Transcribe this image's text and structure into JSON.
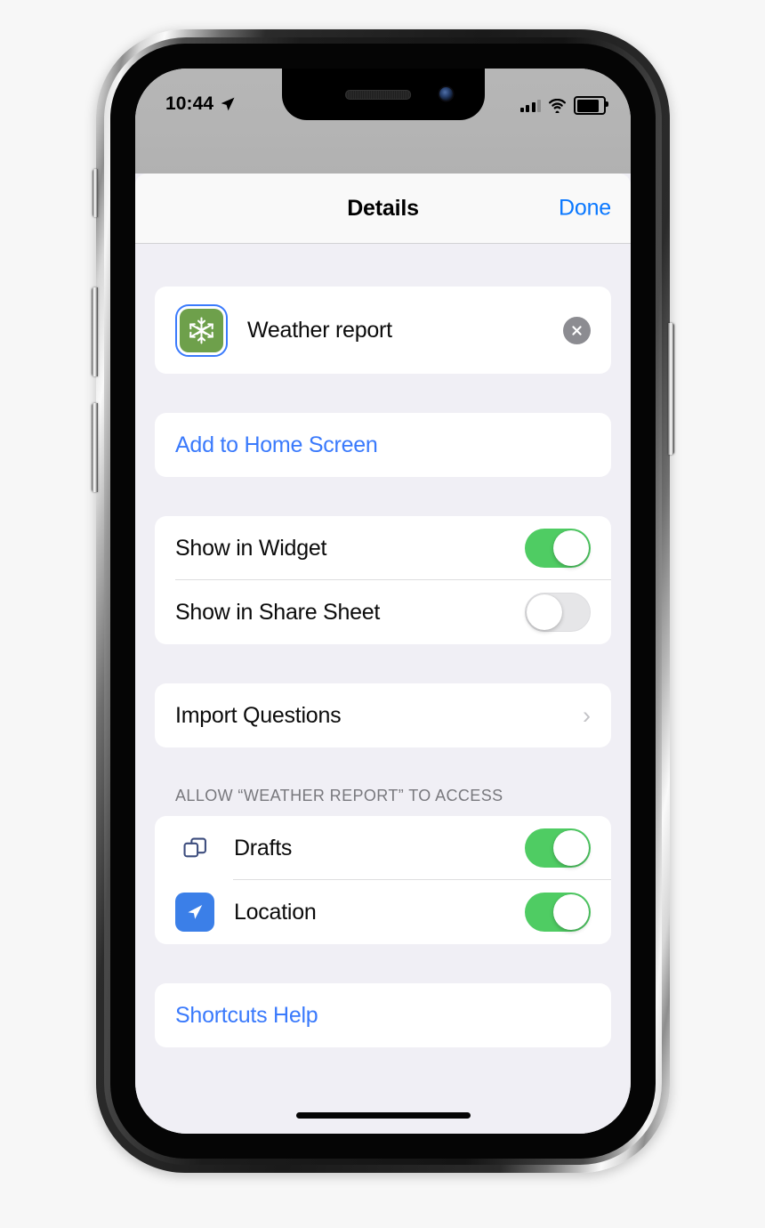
{
  "status_bar": {
    "time": "10:44",
    "location_icon": "location-arrow-icon",
    "signal_icon": "cellular-signal-icon",
    "wifi_icon": "wifi-icon",
    "battery_icon": "battery-icon"
  },
  "navbar": {
    "title": "Details",
    "done_label": "Done"
  },
  "shortcut": {
    "name": "Weather report",
    "icon": "snowflake-icon",
    "icon_color": "#6ea04b",
    "selection_color": "#3a7afc",
    "clear_label": "clear-icon"
  },
  "actions": {
    "add_to_home_screen": "Add to Home Screen",
    "shortcuts_help": "Shortcuts Help"
  },
  "switches": [
    {
      "label": "Show in Widget",
      "state": "on"
    },
    {
      "label": "Show in Share Sheet",
      "state": "off"
    }
  ],
  "import_questions": {
    "label": "Import Questions",
    "chevron": "›"
  },
  "access_section": {
    "header": "ALLOW “WEATHER REPORT” TO ACCESS",
    "items": [
      {
        "label": "Drafts",
        "icon": "drafts-icon",
        "state": "on",
        "icon_color": "#3c4c7d"
      },
      {
        "label": "Location",
        "icon": "location-icon",
        "state": "on",
        "icon_color": "#3b7fe8"
      }
    ]
  },
  "colors": {
    "accent_blue": "#3a7afc",
    "toggle_on_green": "#4fcc63",
    "toggle_off_gray": "#e6e6e8",
    "screen_background": "#f0eff5",
    "card_background": "#ffffff"
  }
}
